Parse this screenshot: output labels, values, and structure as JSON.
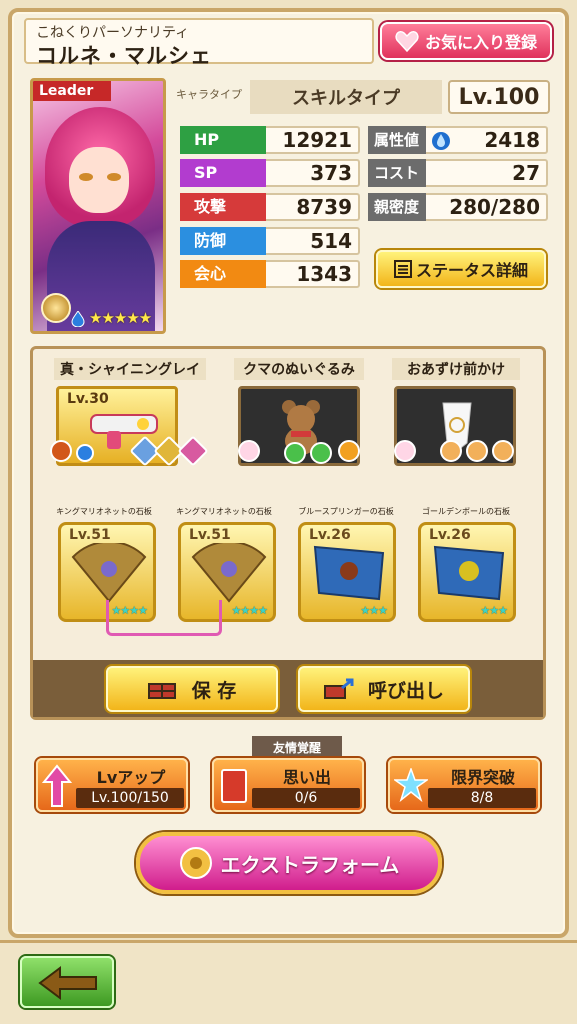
{
  "header": {
    "subtitle": "こねくりパーソナリティ",
    "title": "コルネ・マルシェ",
    "favorite_label": "お気に入り登録"
  },
  "portrait": {
    "leader_label": "Leader",
    "rarity_stars": "★★★★★"
  },
  "type": {
    "label": "キャラタイプ",
    "value": "スキルタイプ",
    "level": "Lv.100"
  },
  "stats": [
    {
      "label": "HP",
      "value": "12921",
      "color": "#2ea043"
    },
    {
      "label": "SP",
      "value": "373",
      "color": "#b23ccf"
    },
    {
      "label": "攻撃",
      "value": "8739",
      "color": "#d63a3a"
    },
    {
      "label": "防御",
      "value": "514",
      "color": "#2b8fe0"
    },
    {
      "label": "会心",
      "value": "1343",
      "color": "#f28a12"
    }
  ],
  "stats_right": [
    {
      "label": "属性値",
      "value": "2418"
    },
    {
      "label": "コスト",
      "value": "27"
    },
    {
      "label": "親密度",
      "value": "280/280"
    }
  ],
  "status_detail_label": "ステータス詳細",
  "equipment": {
    "slots": [
      {
        "title": "真・シャイニングレイ",
        "level": "Lv.30"
      },
      {
        "title": "クマのぬいぐるみ",
        "level": ""
      },
      {
        "title": "おあずけ前かけ",
        "level": ""
      }
    ],
    "stones": [
      {
        "name": "キングマリオネットの石板",
        "level": "Lv.51",
        "stars": "★★★★"
      },
      {
        "name": "キングマリオネットの石板",
        "level": "Lv.51",
        "stars": "★★★★"
      },
      {
        "name": "ブルースプリンガーの石板",
        "level": "Lv.26",
        "stars": "★★★"
      },
      {
        "name": "ゴールデンボールの石板",
        "level": "Lv.26",
        "stars": "★★★"
      }
    ],
    "save_label": "保 存",
    "load_label": "呼び出し"
  },
  "bottom": {
    "levelup_label": "Lvアップ",
    "levelup_value": "Lv.100/150",
    "friend_tag": "友情覚醒",
    "memory_label": "思い出",
    "memory_value": "0/6",
    "limit_label": "限界突破",
    "limit_value": "8/8",
    "extra_label": "エクストラフォーム"
  },
  "icons": [
    "heart-icon",
    "water-element-icon",
    "list-icon",
    "save-icon",
    "load-icon",
    "up-arrow-icon",
    "memory-card-icon",
    "star-icon",
    "gear-emblem-icon",
    "back-arrow-icon"
  ]
}
